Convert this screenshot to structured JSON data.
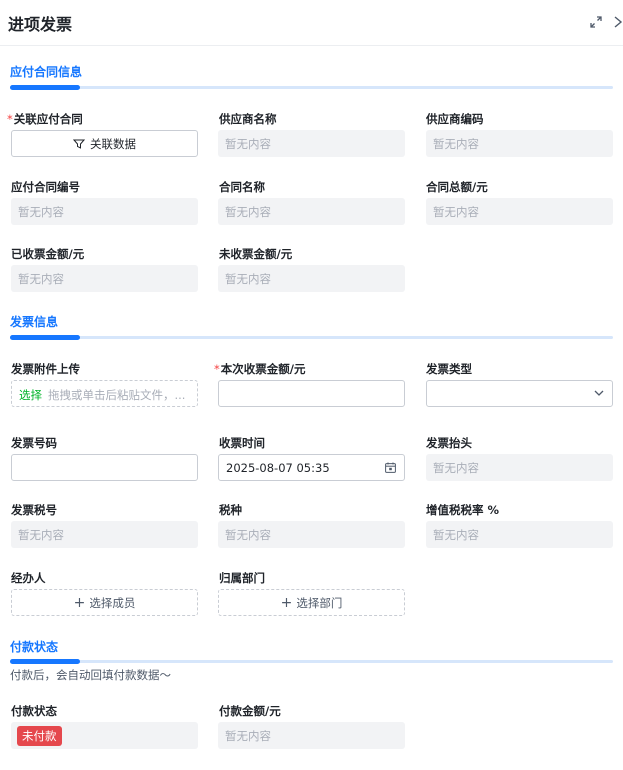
{
  "header": {
    "title": "进项发票"
  },
  "sections": {
    "contract": "应付合同信息",
    "invoice": "发票信息",
    "payment": "付款状态"
  },
  "empty": "暂无内容",
  "contract": {
    "linked_contract_label": "关联应付合同",
    "linked_contract_button": "关联数据",
    "supplier_name_label": "供应商名称",
    "supplier_code_label": "供应商编码",
    "contract_no_label": "应付合同编号",
    "contract_name_label": "合同名称",
    "contract_total_label": "合同总额/元",
    "received_amount_label": "已收票金额/元",
    "unreceived_amount_label": "未收票金额/元"
  },
  "invoice": {
    "attachment_label": "发票附件上传",
    "attachment_select": "选择",
    "attachment_hint": "拖拽或单击后粘贴文件，...",
    "current_amount_label": "本次收票金额/元",
    "type_label": "发票类型",
    "number_label": "发票号码",
    "receive_time_label": "收票时间",
    "receive_time_value": "2025-08-07 05:35",
    "invoice_title_label": "发票抬头",
    "tax_no_label": "发票税号",
    "tax_type_label": "税种",
    "vat_rate_label": "增值税税率 %",
    "handler_label": "经办人",
    "handler_button": "选择成员",
    "department_label": "归属部门",
    "department_button": "选择部门"
  },
  "payment": {
    "note": "付款后，会自动回填付款数据～",
    "status_label": "付款状态",
    "status_value": "未付款",
    "amount_label": "付款金额/元"
  },
  "colors": {
    "accent": "#1677ff",
    "required": "#f53f3f",
    "unpaid_badge": "#e5484d",
    "upload_select": "#00b42a"
  }
}
